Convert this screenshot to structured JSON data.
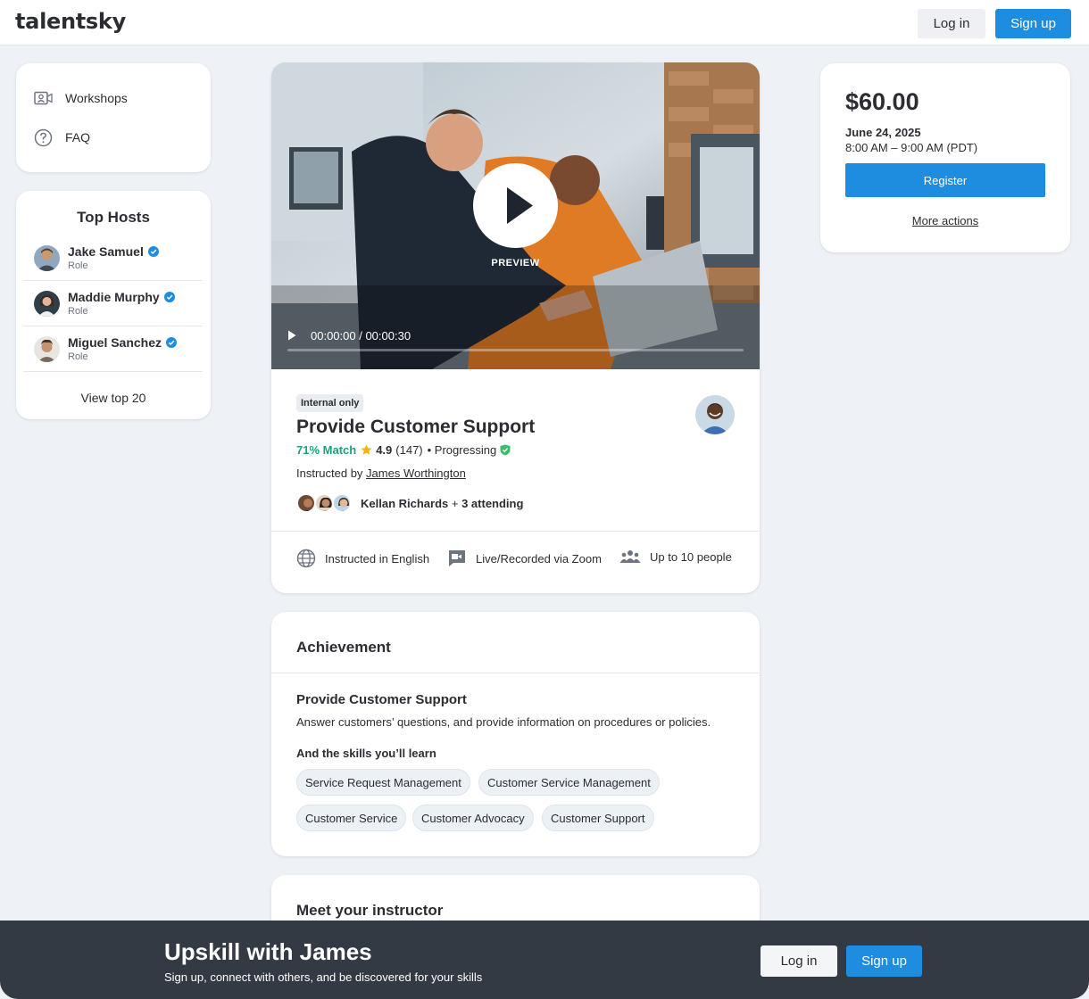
{
  "header": {
    "logo": "talentsky",
    "login_label": "Log in",
    "signup_label": "Sign up"
  },
  "sidebar": {
    "menu": [
      {
        "label": "Workshops",
        "icon": "video-camera-icon"
      },
      {
        "label": "FAQ",
        "icon": "question-circle-icon"
      }
    ],
    "top_hosts": {
      "title": "Top Hosts",
      "hosts": [
        {
          "name": "Jake Samuel",
          "role": "Role",
          "verified": true
        },
        {
          "name": "Maddie Murphy",
          "role": "Role",
          "verified": true
        },
        {
          "name": "Miguel Sanchez",
          "role": "Role",
          "verified": true
        }
      ],
      "view_all_label": "View top 20"
    }
  },
  "course": {
    "video": {
      "preview_label": "PREVIEW",
      "time": "00:00:00 / 00:00:30",
      "progress": 0
    },
    "badge": "Internal only",
    "title": "Provide Customer Support",
    "match": "71% Match",
    "rating": "4.9",
    "reviews": "(147)",
    "status": "• Progressing",
    "instructed_by_prefix": "Instructed by ",
    "instructor": "James Worthington",
    "attending_name": "Kellan Richards",
    "attending_rest": " + ",
    "attending_count": "3 attending",
    "features": [
      {
        "label": "Instructed in English",
        "icon": "globe-icon"
      },
      {
        "label": "Live/Recorded via Zoom",
        "icon": "video-chat-icon"
      },
      {
        "label": "Up to 10 people",
        "icon": "people-icon"
      }
    ]
  },
  "achievement": {
    "title": "Achievement",
    "name": "Provide Customer Support",
    "description": "Answer customers’ questions, and provide information on procedures or policies.",
    "skills_title": "And the skills you’ll learn",
    "skills": [
      "Service Request Management",
      "Customer Service Management",
      "Customer Service",
      "Customer Advocacy",
      "Customer Support"
    ]
  },
  "instructor_section": {
    "title": "Meet your instructor"
  },
  "pricing": {
    "price": "$60.00",
    "date": "June 24, 2025",
    "time": "8:00 AM – 9:00 AM (PDT)",
    "register_label": "Register",
    "more_actions_label": "More actions"
  },
  "banner": {
    "title": "Upskill with James",
    "subtitle": "Sign up, connect with others, and be discovered for your skills",
    "login_label": "Log in",
    "signup_label": "Sign up"
  },
  "colors": {
    "accent": "#1e8de0",
    "match": "#1aa37a",
    "star": "#f5b400",
    "banner": "#343a43",
    "background": "#eef1f5"
  }
}
